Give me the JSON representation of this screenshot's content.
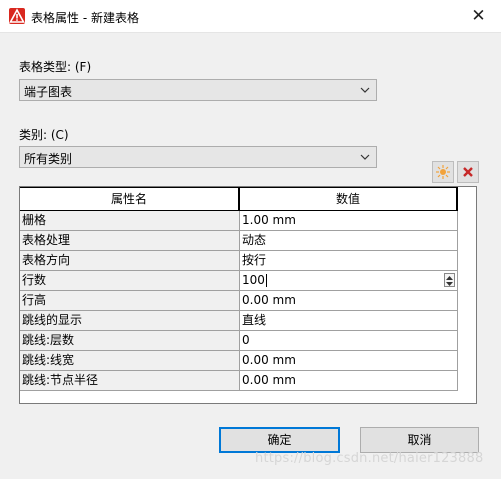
{
  "window": {
    "title": "表格属性 - 新建表格",
    "close_symbol": "✕"
  },
  "table_type": {
    "label": "表格类型: (F)",
    "selected": "端子图表"
  },
  "category": {
    "label": "类别: (C)",
    "selected": "所有类别"
  },
  "toolbar": {
    "new_icon": "sun-icon",
    "delete_icon": "x-icon"
  },
  "grid": {
    "headers": [
      "属性名",
      "数值"
    ],
    "rows": [
      {
        "name": "栅格",
        "value": "1.00 mm"
      },
      {
        "name": "表格处理",
        "value": "动态"
      },
      {
        "name": "表格方向",
        "value": "按行"
      },
      {
        "name": "行数",
        "value": "100"
      },
      {
        "name": "行高",
        "value": "0.00 mm"
      },
      {
        "name": "跳线的显示",
        "value": "直线"
      },
      {
        "name": "跳线:层数",
        "value": "0"
      },
      {
        "name": "跳线:线宽",
        "value": "0.00 mm"
      },
      {
        "name": "跳线:节点半径",
        "value": "0.00 mm"
      }
    ]
  },
  "buttons": {
    "ok": "确定",
    "cancel": "取消"
  },
  "watermark": "https://blog.csdn.net/haier123888",
  "colors": {
    "accent": "#0078d7",
    "app_icon": "#d9281f",
    "delete_icon": "#c62828",
    "new_icon": "#f2a23a"
  }
}
